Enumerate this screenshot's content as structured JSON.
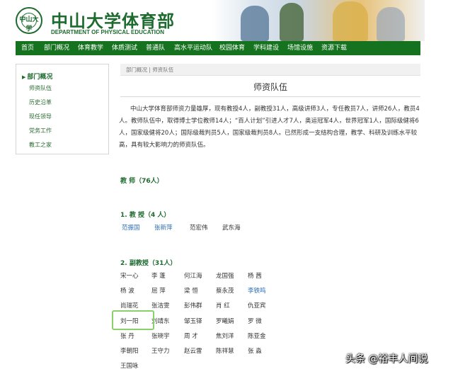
{
  "header": {
    "cn_title": "中山大学体育部",
    "en_title": "DEPARTMENT OF PHYSICAL EDUCATION",
    "logo_mark": "中山大学"
  },
  "nav": [
    "首页",
    "部门概况",
    "体育教学",
    "体质测试",
    "普通队",
    "高水平运动队",
    "校园体育",
    "学科建设",
    "场馆设施",
    "资源下载"
  ],
  "sidebar": {
    "heading": "部门概况",
    "items": [
      "师资队伍",
      "历史沿革",
      "现任领导",
      "党务工作",
      "教工之家"
    ]
  },
  "breadcrumb": "部门概况  |  师资队伍",
  "page_title": "师资队伍",
  "intro": "中山大学体育部师资力量雄厚，现有教授4人，副教授31人，高级讲师3人，专任教员7人，讲师26人，教员4人。教师队伍中，取得博士学位教师14人；“百人计划”引进人才7人，奥运冠军4人，世界冠军1人，国际级健将6人，国家级健将20人；国际级裁判员5人，国家级裁判员8人。已然形成一支结构合理，教学、科研及训练水平较高，具有较大影响力的师资队伍。",
  "sections": {
    "teachers": "教  师（76人）",
    "professors": "1. 教  授（4 人）",
    "associate": "2. 副教授（31人）"
  },
  "professors": [
    "范振国",
    "张新萍",
    "范宏伟",
    "武东海"
  ],
  "associate_professors": [
    [
      "宋一心",
      "李  蓬",
      "何江海",
      "龙国强",
      "杨  茜"
    ],
    [
      "杨  波",
      "屈  萍",
      "梁  恒",
      "蔡永茂",
      "李铁鸣"
    ],
    [
      "尚瑞花",
      "张洁雯",
      "彭伟群",
      "肖  红",
      "仇亚宾"
    ],
    [
      "刘一阳",
      "刘靖东",
      "邹玉铎",
      "罗曦娟",
      "罗  微"
    ],
    [
      "张  丹",
      "张晓宇",
      "周  才",
      "焦刘洋",
      "陈亚金"
    ],
    [
      "李朝阳",
      "王守力",
      "赵云雷",
      "陈祥慧",
      "张  淼"
    ],
    [
      "王国咏"
    ]
  ],
  "link_colors": {
    "link": "#2a6cb5",
    "brand": "#15721f"
  },
  "watermark": "头条 @裕丰人间说"
}
